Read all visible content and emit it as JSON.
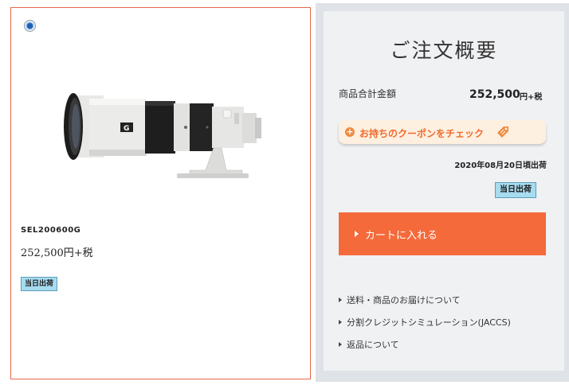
{
  "product": {
    "code": "SEL200600G",
    "price": "252,500円+税",
    "badge": "当日出荷",
    "image_icon": "camera-lens-image",
    "radio_icon": "radio-selected-icon"
  },
  "summary": {
    "title": "ご注文概要",
    "subtotal_label": "商品合計金額",
    "subtotal_value": "252,500",
    "subtotal_suffix": "円+税",
    "coupon_label": "お持ちのクーポンをチェック",
    "delivery_date": "2020年08月20日頃出荷",
    "badge": "当日出荷",
    "cart_label": "カートに入れる",
    "links": [
      {
        "label": "送料・商品のお届けについて"
      },
      {
        "label": "分割クレジットシミュレーション(JACCS)"
      },
      {
        "label": "返品について"
      }
    ]
  },
  "colors": {
    "accent": "#f46a3b",
    "card_border": "#e4694a",
    "badge_bg": "#a6dcef",
    "coupon_bg": "#fdf0e0",
    "coupon_text": "#f26a2d"
  }
}
